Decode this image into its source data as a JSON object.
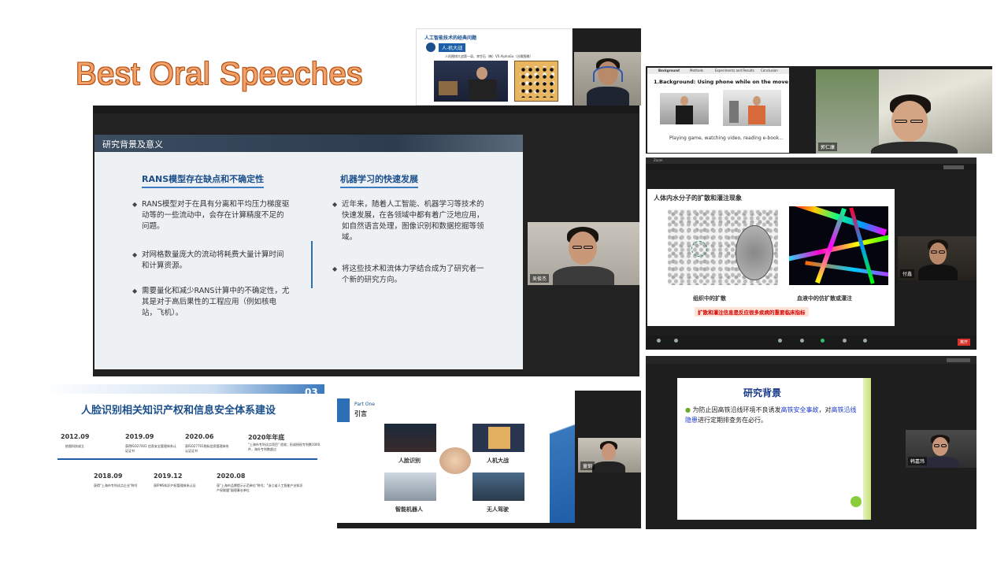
{
  "page": {
    "title": "Best Oral Speeches"
  },
  "main_slide": {
    "header": "研究背景及意义",
    "left_heading": "RANS模型存在缺点和不确定性",
    "left_bullets": [
      "RANS模型对于在具有分离和平均压力梯度驱动等的一些流动中，会存在计算精度不足的问题。",
      "对网格数量庞大的流动将耗费大量计算时间和计算资源。",
      "需要量化和减少RANS计算中的不确定性，尤其是对于高后果性的工程应用（例如核电站，飞机）。"
    ],
    "right_heading": "机器学习的快速发展",
    "right_bullets": [
      "近年来，随着人工智能、机器学习等技术的快速发展，在各领域中都有着广泛地应用，如自然语言处理，图像识别和数据挖掘等领域。",
      "将这些技术和流体力学结合成为了研究者一个新的研究方向。"
    ],
    "speaker_name": "吴俊杰"
  },
  "top_center_slide": {
    "title": "人工智能技术的经典问题",
    "badge": "人-机大战",
    "caption": "人机围棋大战第一局，李世石（韩）VS AlphaGo（谷歌围棋）"
  },
  "top_right_slide": {
    "tabs": [
      "Background",
      "Methods",
      "Experiments and Results",
      "Conclusion"
    ],
    "heading": "1.Background: Using phone while on the move",
    "caption": "Playing game, watching video, reading e-book...",
    "speaker_name": "郭仁康"
  },
  "mid_right_slide": {
    "window_title": "Zoom",
    "title": "人体内水分子的扩散和灌注现象",
    "label_left": "组织中的扩散",
    "label_right": "血液中的仿扩散或灌注",
    "footer": "扩散和灌注信息是反应很多疾病的重要临床指标",
    "leave_button": "离开",
    "speaker_name": "付鑫"
  },
  "bottom_left_slide": {
    "title": "人脸识别相关知识产权和信息安全体系建设",
    "badge": "03",
    "timeline_top": [
      {
        "year": "2012.09",
        "text": "依图科技成立"
      },
      {
        "year": "2019.09",
        "text": "获得ISO27001 信息安全管理体系认证证书"
      },
      {
        "year": "2020.06",
        "text": "获ISO27701隐私信息管理体系认证证书"
      },
      {
        "year": "2020年年底",
        "text": "\"上海市专利试点项目\" 验收；形成授权专利数1000件，海外专利数超过"
      }
    ],
    "timeline_bottom": [
      {
        "year": "2018.09",
        "text": "获得\"上海市专利试点企业\"称号"
      },
      {
        "year": "2019.12",
        "text": "获IPMS知识产权管理体系认证"
      },
      {
        "year": "2020.08",
        "text": "获\"上海市品牌提示示范单位\"称号；\"浙江省人工智能产业知识产权联盟\"副理事长单位"
      }
    ]
  },
  "bottom_center_slide": {
    "part": "Part One",
    "heading": "引言",
    "items": [
      "人脸识别",
      "人机大战",
      "智能机器人",
      "无人驾驶"
    ],
    "speaker_name": "童钢"
  },
  "bottom_right_slide": {
    "title": "研究背景",
    "bullet_prefix": "为防止因高铁沿线环境不良诱发",
    "bullet_hl1": "高铁安全事故",
    "bullet_mid": "，对",
    "bullet_hl2": "高铁沿线隐患",
    "bullet_suffix": "进行定期排查务在必行。",
    "speaker_name": "韩嘉玮"
  },
  "colors": {
    "title_orange": "#f0a26a",
    "slide_blue": "#1b4f8c",
    "accent_blue": "#2d6fb5"
  }
}
